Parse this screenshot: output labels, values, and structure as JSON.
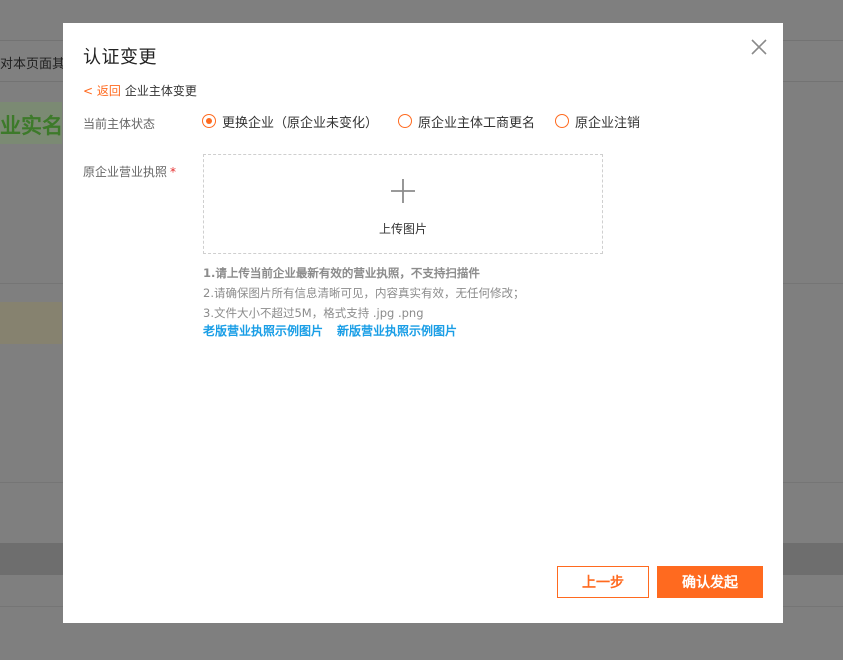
{
  "background": {
    "truncated_strip_text": "对本页面其",
    "truncated_heading": "业实名认"
  },
  "modal": {
    "title": "认证变更",
    "close_icon": "close-icon",
    "breadcrumb": {
      "back_label": "< 返回",
      "current": "企业主体变更"
    },
    "status": {
      "label": "当前主体状态",
      "options": [
        {
          "label": "更换企业（原企业未变化）",
          "checked": true
        },
        {
          "label": "原企业主体工商更名",
          "checked": false
        },
        {
          "label": "原企业注销",
          "checked": false
        }
      ]
    },
    "license": {
      "label": "原企业营业执照",
      "required_mark": "*",
      "upload_label": "上传图片",
      "upload_icon": "plus-icon"
    },
    "tips": [
      "1.请上传当前企业最新有效的营业执照，不支持扫描件",
      "2.请确保图片所有信息清晰可见，内容真实有效，无任何修改；",
      "3.文件大小不超过5M，格式支持 .jpg .png"
    ],
    "links": {
      "old_sample": "老版营业执照示例图片",
      "new_sample": "新版营业执照示例图片"
    },
    "buttons": {
      "prev": "上一步",
      "confirm": "确认发起"
    },
    "colors": {
      "accent": "#ff6a1f",
      "link": "#1a9ee6",
      "required": "#e62e2e"
    }
  }
}
